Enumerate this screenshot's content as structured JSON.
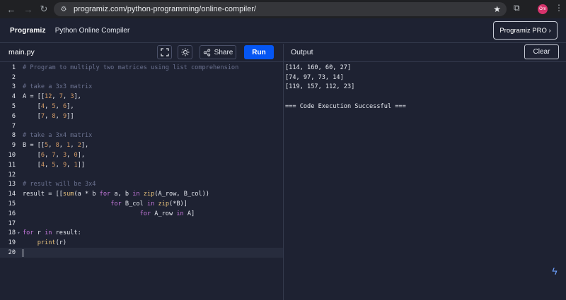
{
  "browser": {
    "url": "programiz.com/python-programming/online-compiler/",
    "avatar_initials": "Om"
  },
  "header": {
    "logo_text": "Programiz",
    "title": "Python Online Compiler",
    "pro_button": "Programiz PRO ›"
  },
  "toolbar": {
    "file_tab": "main.py",
    "share_label": "Share",
    "run_label": "Run",
    "output_title": "Output",
    "clear_label": "Clear"
  },
  "editor": {
    "lines": [
      {
        "num": "1",
        "fold": "",
        "text": "# Program to multiply two matrices using list comprehension"
      },
      {
        "num": "2",
        "fold": "",
        "text": ""
      },
      {
        "num": "3",
        "fold": "",
        "text": "# take a 3x3 matrix"
      },
      {
        "num": "4",
        "fold": "",
        "text": "A = [[12, 7, 3],"
      },
      {
        "num": "5",
        "fold": "",
        "text": "    [4, 5, 6],"
      },
      {
        "num": "6",
        "fold": "",
        "text": "    [7, 8, 9]]"
      },
      {
        "num": "7",
        "fold": "",
        "text": ""
      },
      {
        "num": "8",
        "fold": "",
        "text": "# take a 3x4 matrix"
      },
      {
        "num": "9",
        "fold": "",
        "text": "B = [[5, 8, 1, 2],"
      },
      {
        "num": "10",
        "fold": "",
        "text": "    [6, 7, 3, 0],"
      },
      {
        "num": "11",
        "fold": "",
        "text": "    [4, 5, 9, 1]]"
      },
      {
        "num": "12",
        "fold": "",
        "text": ""
      },
      {
        "num": "13",
        "fold": "",
        "text": "# result will be 3x4"
      },
      {
        "num": "14",
        "fold": "",
        "text": "result = [[sum(a * b for a, b in zip(A_row, B_col))"
      },
      {
        "num": "15",
        "fold": "",
        "text": "                        for B_col in zip(*B)]"
      },
      {
        "num": "16",
        "fold": "",
        "text": "                                for A_row in A]"
      },
      {
        "num": "17",
        "fold": "",
        "text": ""
      },
      {
        "num": "18",
        "fold": "▾",
        "text": "for r in result:"
      },
      {
        "num": "19",
        "fold": "",
        "text": "    print(r)"
      },
      {
        "num": "20",
        "fold": "",
        "text": ""
      }
    ]
  },
  "output": {
    "lines": [
      "[114, 160, 60, 27]",
      "[74, 97, 73, 14]",
      "[119, 157, 112, 23]",
      "",
      "=== Code Execution Successful ==="
    ]
  },
  "icons": [
    "back-arrow-icon",
    "forward-arrow-icon",
    "reload-icon",
    "site-settings-icon",
    "bookmark-star-icon",
    "extensions-icon",
    "browser-menu-icon",
    "fullscreen-icon",
    "theme-toggle-icon",
    "share-icon",
    "assistant-fab-icon"
  ],
  "colors": {
    "run": "#0556f3",
    "background": "#1e2232",
    "comment": "#6b7290",
    "number": "#d19a66"
  }
}
